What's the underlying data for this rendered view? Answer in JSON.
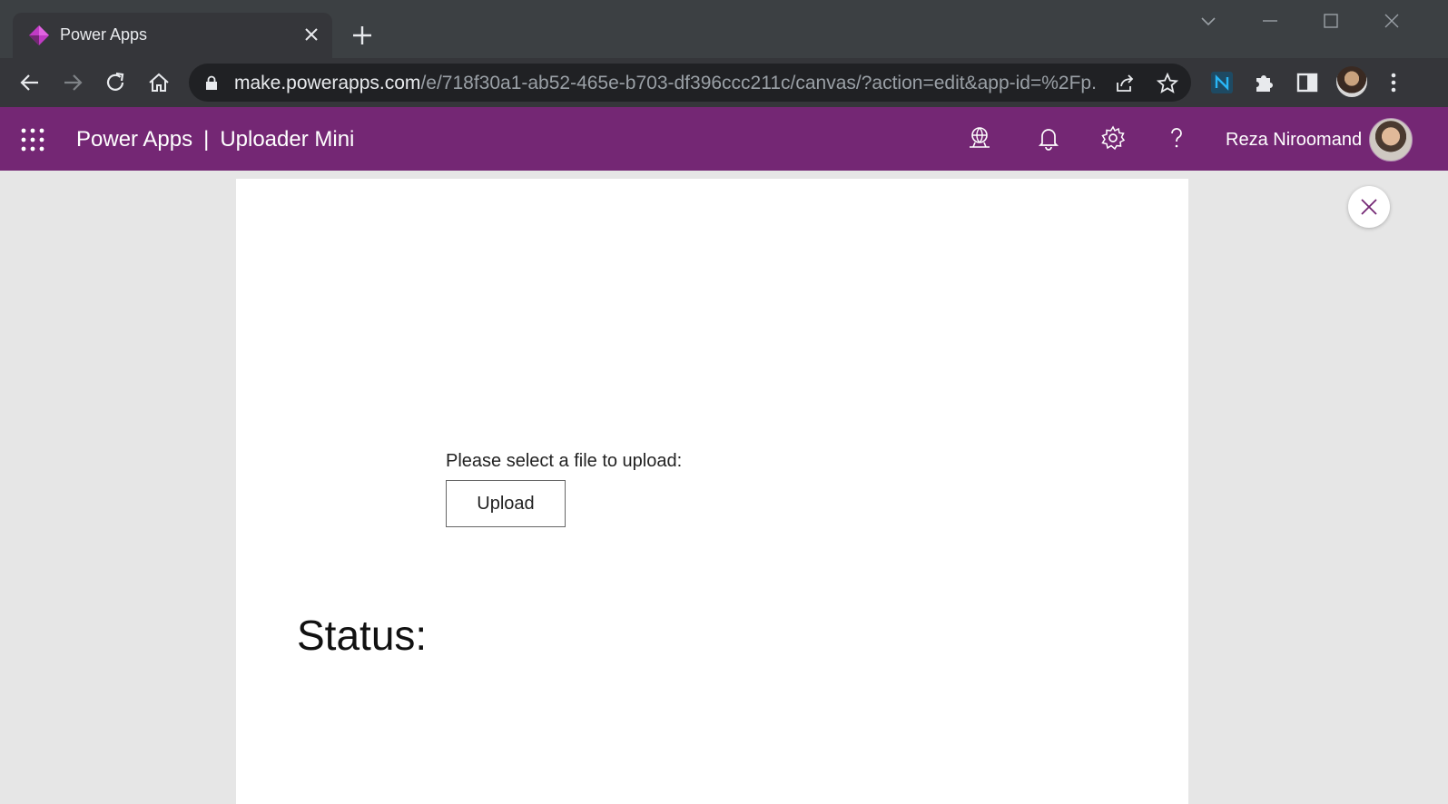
{
  "browser": {
    "tab_title": "Power Apps",
    "url_host": "make.powerapps.com",
    "url_path": "/e/718f30a1-ab52-465e-b703-df396ccc211c/canvas/?action=edit&app-id=%2Fp..."
  },
  "header": {
    "product": "Power Apps",
    "separator": "|",
    "app_name": "Uploader Mini",
    "user_name": "Reza Niroomand"
  },
  "app": {
    "prompt": "Please select a file to upload:",
    "upload_label": "Upload",
    "status_label": "Status:"
  },
  "colors": {
    "brand": "#742774",
    "browser_frame": "#3c4043",
    "canvas_bg": "#e6e6e6"
  },
  "icons": [
    "power-apps-favicon",
    "close-icon",
    "plus-icon",
    "chevron-down-icon",
    "minimize-icon",
    "maximize-icon",
    "back-icon",
    "forward-icon",
    "reload-icon",
    "home-icon",
    "lock-icon",
    "share-icon",
    "star-icon",
    "extension-icon",
    "puzzle-icon",
    "sidebar-icon",
    "kebab-icon",
    "waffle-icon",
    "environment-icon",
    "bell-icon",
    "gear-icon",
    "help-icon"
  ]
}
